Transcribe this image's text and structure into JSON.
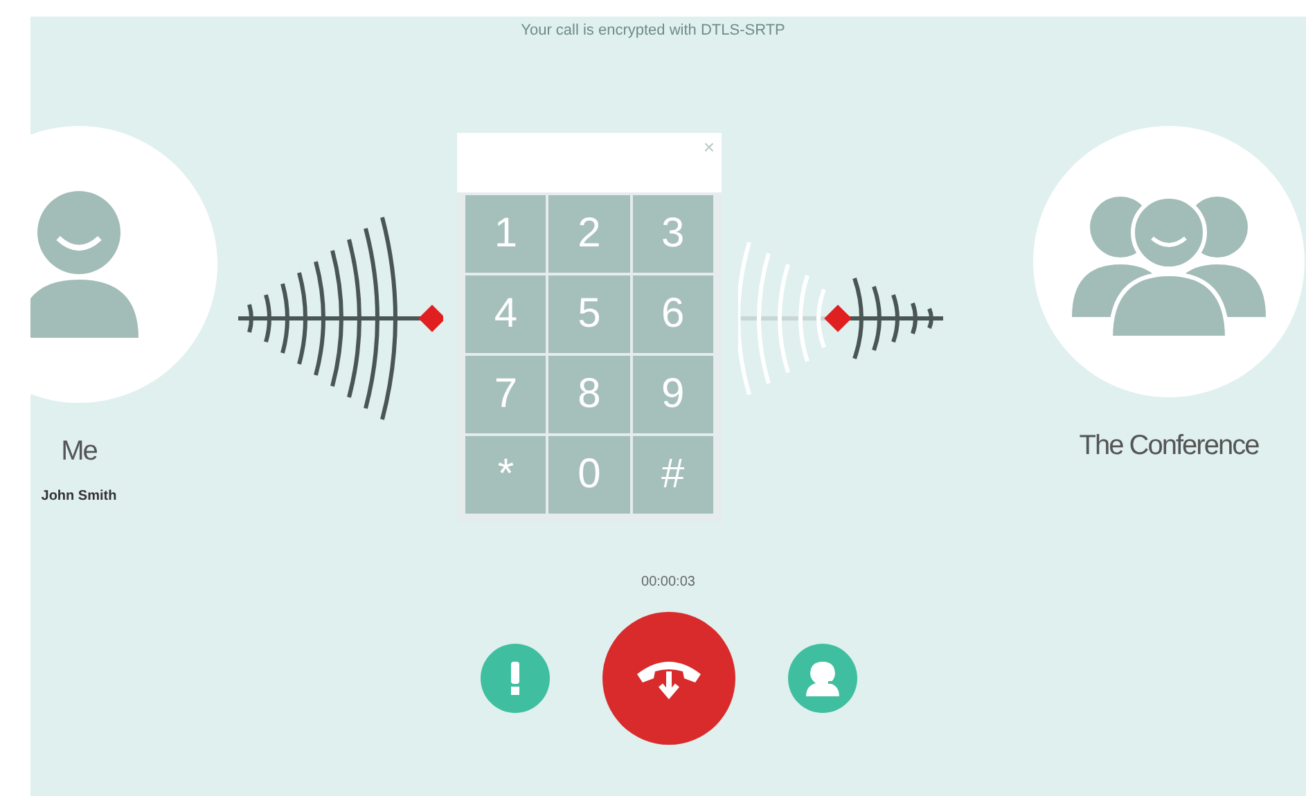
{
  "notice": "Your call is encrypted with DTLS-SRTP",
  "me": {
    "name": "Me",
    "user": "John Smith"
  },
  "remote": {
    "name": "The Conference"
  },
  "dialpad": {
    "close": "×",
    "keys": [
      "1",
      "2",
      "3",
      "4",
      "5",
      "6",
      "7",
      "8",
      "9",
      "*",
      "0",
      "#"
    ]
  },
  "timer": "00:00:03"
}
